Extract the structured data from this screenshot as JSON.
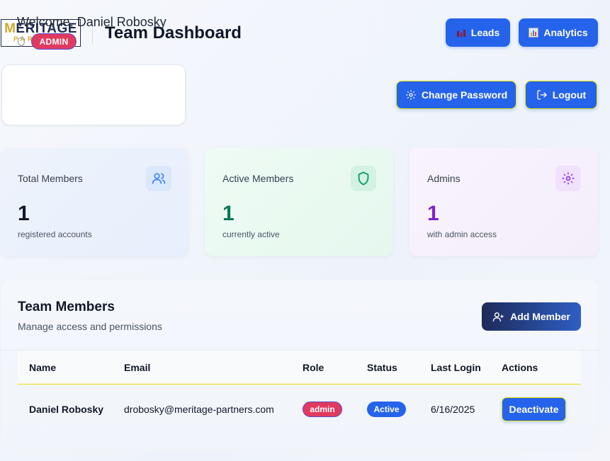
{
  "header": {
    "logo_top": "ERITAGE",
    "logo_m": "M",
    "logo_bottom": "PARTNERS",
    "title": "Team Dashboard",
    "leads_label": "Leads",
    "leads_icon": "bar-chart-icon",
    "analytics_label": "Analytics",
    "analytics_icon": "analytics-icon"
  },
  "welcome": {
    "greeting": "Welcome, Daniel Robosky",
    "role_badge": "ADMIN",
    "change_password_label": "Change Password",
    "logout_label": "Logout"
  },
  "stats": [
    {
      "label": "Total Members",
      "value": "1",
      "sub": "registered accounts",
      "icon": "users-icon",
      "color": "#0f172a",
      "icon_color": "#3b82f6"
    },
    {
      "label": "Active Members",
      "value": "1",
      "sub": "currently active",
      "icon": "shield-icon",
      "color": "#047857",
      "icon_color": "#059669"
    },
    {
      "label": "Admins",
      "value": "1",
      "sub": "with admin access",
      "icon": "gear-icon",
      "color": "#7e22ce",
      "icon_color": "#9333ea"
    }
  ],
  "team": {
    "title": "Team Members",
    "subtitle": "Manage access and permissions",
    "add_label": "Add Member",
    "columns": [
      "Name",
      "Email",
      "Role",
      "Status",
      "Last Login",
      "Actions"
    ],
    "rows": [
      {
        "name": "Daniel Robosky",
        "email": "drobosky@meritage-partners.com",
        "role": "admin",
        "status": "Active",
        "last_login": "6/16/2025",
        "action": "Deactivate"
      }
    ]
  },
  "colors": {
    "primary": "#2563eb",
    "admin_badge": "#e03a5f",
    "brand_navy": "#1d2b50",
    "brand_gold": "#d4a72c"
  }
}
